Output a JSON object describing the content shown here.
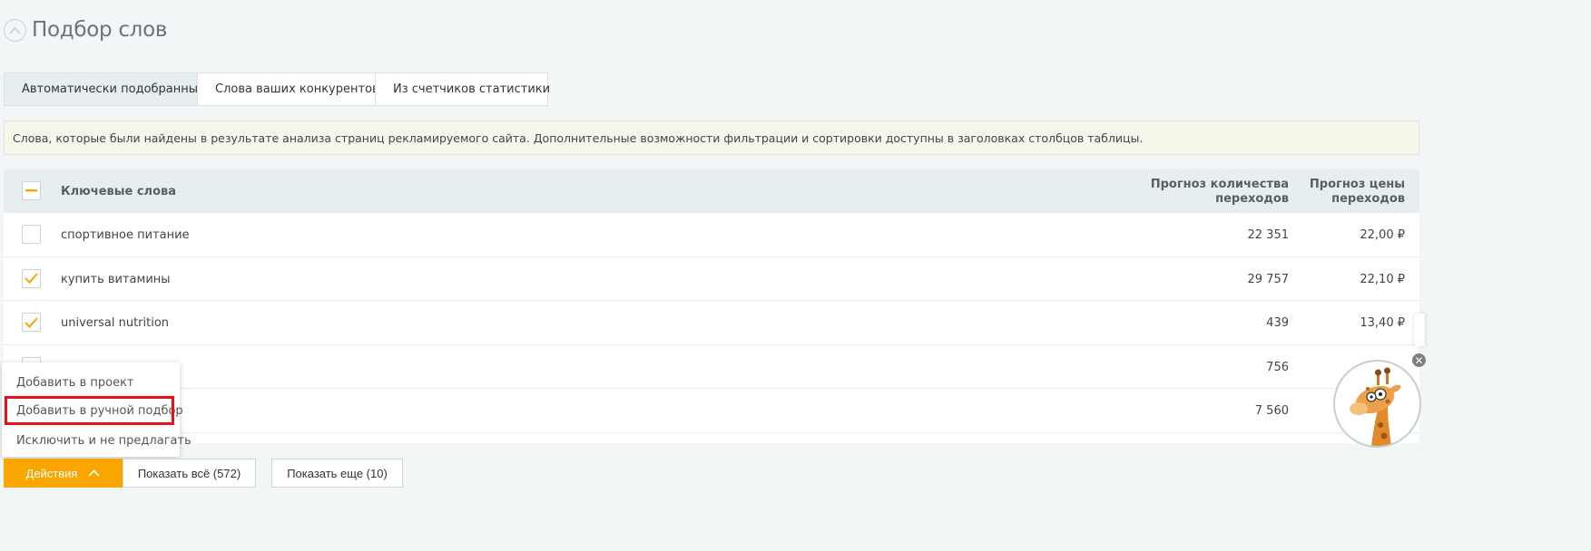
{
  "header": {
    "title": "Подбор слов",
    "collapse_icon": "chevron-up-circle-icon"
  },
  "tabs": [
    {
      "label": "Автоматически подобранные",
      "active": true
    },
    {
      "label": "Слова ваших конкурентов",
      "active": false
    },
    {
      "label": "Из счетчиков статистики",
      "active": false
    }
  ],
  "info_text": "Слова, которые были найдены в результате анализа страниц рекламируемого сайта. Дополнительные возможности фильтрации и сортировки доступны в заголовках столбцов таблицы.",
  "table": {
    "columns": {
      "keyword": "Ключевые слова",
      "clicks_line1": "Прогноз количества",
      "clicks_line2": "переходов",
      "price_line1": "Прогноз цены",
      "price_line2": "переходов"
    },
    "header_checkbox_state": "indeterminate",
    "rows": [
      {
        "keyword": "спортивное питание",
        "clicks": "22 351",
        "price": "22,00 ₽",
        "checked": false
      },
      {
        "keyword": "купить витамины",
        "clicks": "29 757",
        "price": "22,10 ₽",
        "checked": true
      },
      {
        "keyword": "universal nutrition",
        "clicks": "439",
        "price": "13,40 ₽",
        "checked": true
      },
      {
        "keyword": "",
        "clicks": "756",
        "price": "",
        "checked": false
      },
      {
        "keyword": "",
        "clicks": "7 560",
        "price": "",
        "checked": false
      }
    ]
  },
  "actions_menu": {
    "items": [
      {
        "label": "Добавить в проект"
      },
      {
        "label": "Добавить в ручной подбор",
        "highlighted": true
      },
      {
        "label": "Исключить и не предлагать"
      }
    ]
  },
  "bottom": {
    "actions_label": "Действия",
    "show_all_label": "Показать всё (572)",
    "show_more_label": "Показать еще (10)"
  },
  "assistant": {
    "icon": "giraffe-assistant-icon",
    "close_icon": "close-icon"
  },
  "colors": {
    "accent": "#f9a600",
    "highlight_border": "#e8101b",
    "header_bg": "#e6eef0",
    "info_bg": "#f7f6ea"
  }
}
